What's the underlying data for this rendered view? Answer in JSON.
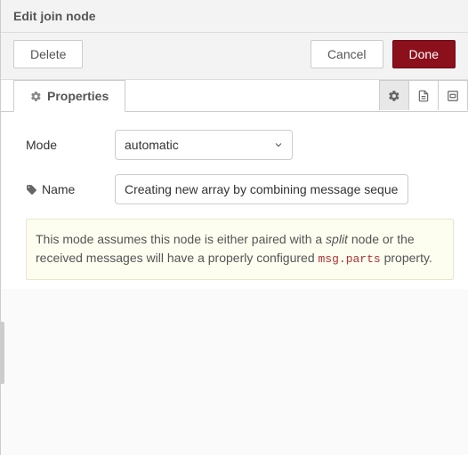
{
  "header": {
    "title": "Edit join node"
  },
  "buttons": {
    "delete": "Delete",
    "cancel": "Cancel",
    "done": "Done"
  },
  "tabs": {
    "properties": "Properties"
  },
  "form": {
    "mode_label": "Mode",
    "mode_value": "automatic",
    "name_label": "Name",
    "name_value": "Creating new array by combining message sequen"
  },
  "note": {
    "pre": "This mode assumes this node is either paired with a ",
    "em": "split",
    "mid": " node or the received messages will have a properly configured ",
    "code": "msg.parts",
    "post": " property."
  }
}
